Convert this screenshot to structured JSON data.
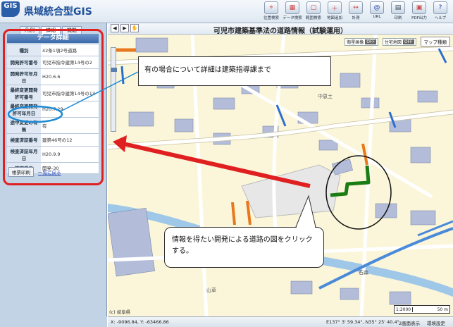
{
  "header": {
    "logo_mark": "GIS",
    "app_title": "県域統合型GIS",
    "tools": [
      {
        "icon": "position-search-icon",
        "label": "位置検索"
      },
      {
        "icon": "data-search-icon",
        "label": "データ検索"
      },
      {
        "icon": "range-search-icon",
        "label": "範囲検索"
      },
      {
        "icon": "map-add-icon",
        "label": "地図追加"
      },
      {
        "icon": "measure-icon",
        "label": "計測"
      },
      {
        "icon": "url-icon",
        "label": "URL"
      },
      {
        "icon": "print-icon",
        "label": "印刷"
      },
      {
        "icon": "pdf-icon",
        "label": "PDF出力"
      },
      {
        "icon": "help-icon",
        "label": "ヘルプ"
      }
    ]
  },
  "left_panel": {
    "tabs": [
      "凡例",
      "詳細",
      "機能"
    ],
    "title": "データ詳細",
    "rows": [
      {
        "key": "種別",
        "value": "42条1項2号道路"
      },
      {
        "key": "開発許可番号",
        "value": "可児市指令建第14号の2"
      },
      {
        "key": "開発許可年月日",
        "value": "H20.6.6"
      },
      {
        "key": "最終変更開発許可番号",
        "value": "可児市指令建第14号の13"
      },
      {
        "key": "最終変更開発許可年月日",
        "value": "H20.7.29"
      },
      {
        "key": "途中変更の有無",
        "value": "有"
      },
      {
        "key": "検査済証番号",
        "value": "建第46号の12"
      },
      {
        "key": "検査済証年月日",
        "value": "H20.9.9"
      },
      {
        "key": "管理番号",
        "value": "開発-30"
      }
    ],
    "print_button": "帳票印刷",
    "back_link": "一覧に戻る"
  },
  "map": {
    "title": "可児市建築基準法の道路情報（試験運用）",
    "layers": [
      {
        "label": "衛星画像",
        "state": "OFF"
      },
      {
        "label": "住宅地図",
        "state": "OFF"
      }
    ],
    "switch_label": "マップ種類",
    "zoom_level": 0.25,
    "place_labels": [
      "中恵土",
      "石森",
      "山草"
    ],
    "copyright": "(c) 岐阜県",
    "scale_ratio": "1:2000",
    "scale_bar": "50 m"
  },
  "status_bar": {
    "coords": "X: -9096.84,  Y: -63466.86",
    "latlon": "E137° 3' 59.34\",  N35° 25' 40.4\"",
    "display2": "2画面表示",
    "environment": "環境設定"
  },
  "callouts": {
    "detail": "有の場合について詳細は建築指導課まで",
    "click": "情報を得たい開発による道路の図をクリックする。"
  },
  "colors": {
    "annotation_red": "#e02020",
    "highlight_blue": "#1c8ad6",
    "road_orange": "#e8781e",
    "road_green": "#1a7d14",
    "road_blue": "#2a6fd0"
  }
}
